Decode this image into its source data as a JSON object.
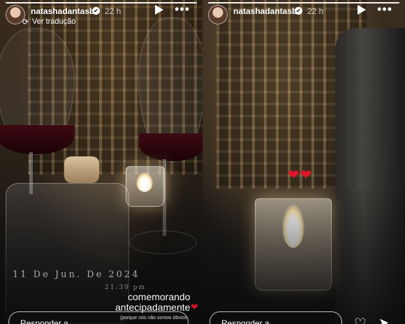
{
  "stories": [
    {
      "username": "natashadantasb",
      "time_ago": "22 h",
      "translate_label": "Ver tradução",
      "date_overlay": "11 De Jun. De 2024",
      "time_overlay": "21:39 pm",
      "caption_line1": "comemorando",
      "caption_line2": "antecipadamente",
      "caption_small": "(porque nós não somos óbvios",
      "reply_placeholder": "Responder a..."
    },
    {
      "username": "natashadantasb",
      "time_ago": "22 h",
      "reply_placeholder": "Responder a..."
    }
  ],
  "icons": {
    "verified": "✔",
    "play": "play-icon",
    "more": "•••",
    "heart": "❤",
    "like": "♡",
    "send": "➤",
    "translate": "⟳"
  },
  "colors": {
    "heart": "#d8152b",
    "text": "#ffffff"
  }
}
